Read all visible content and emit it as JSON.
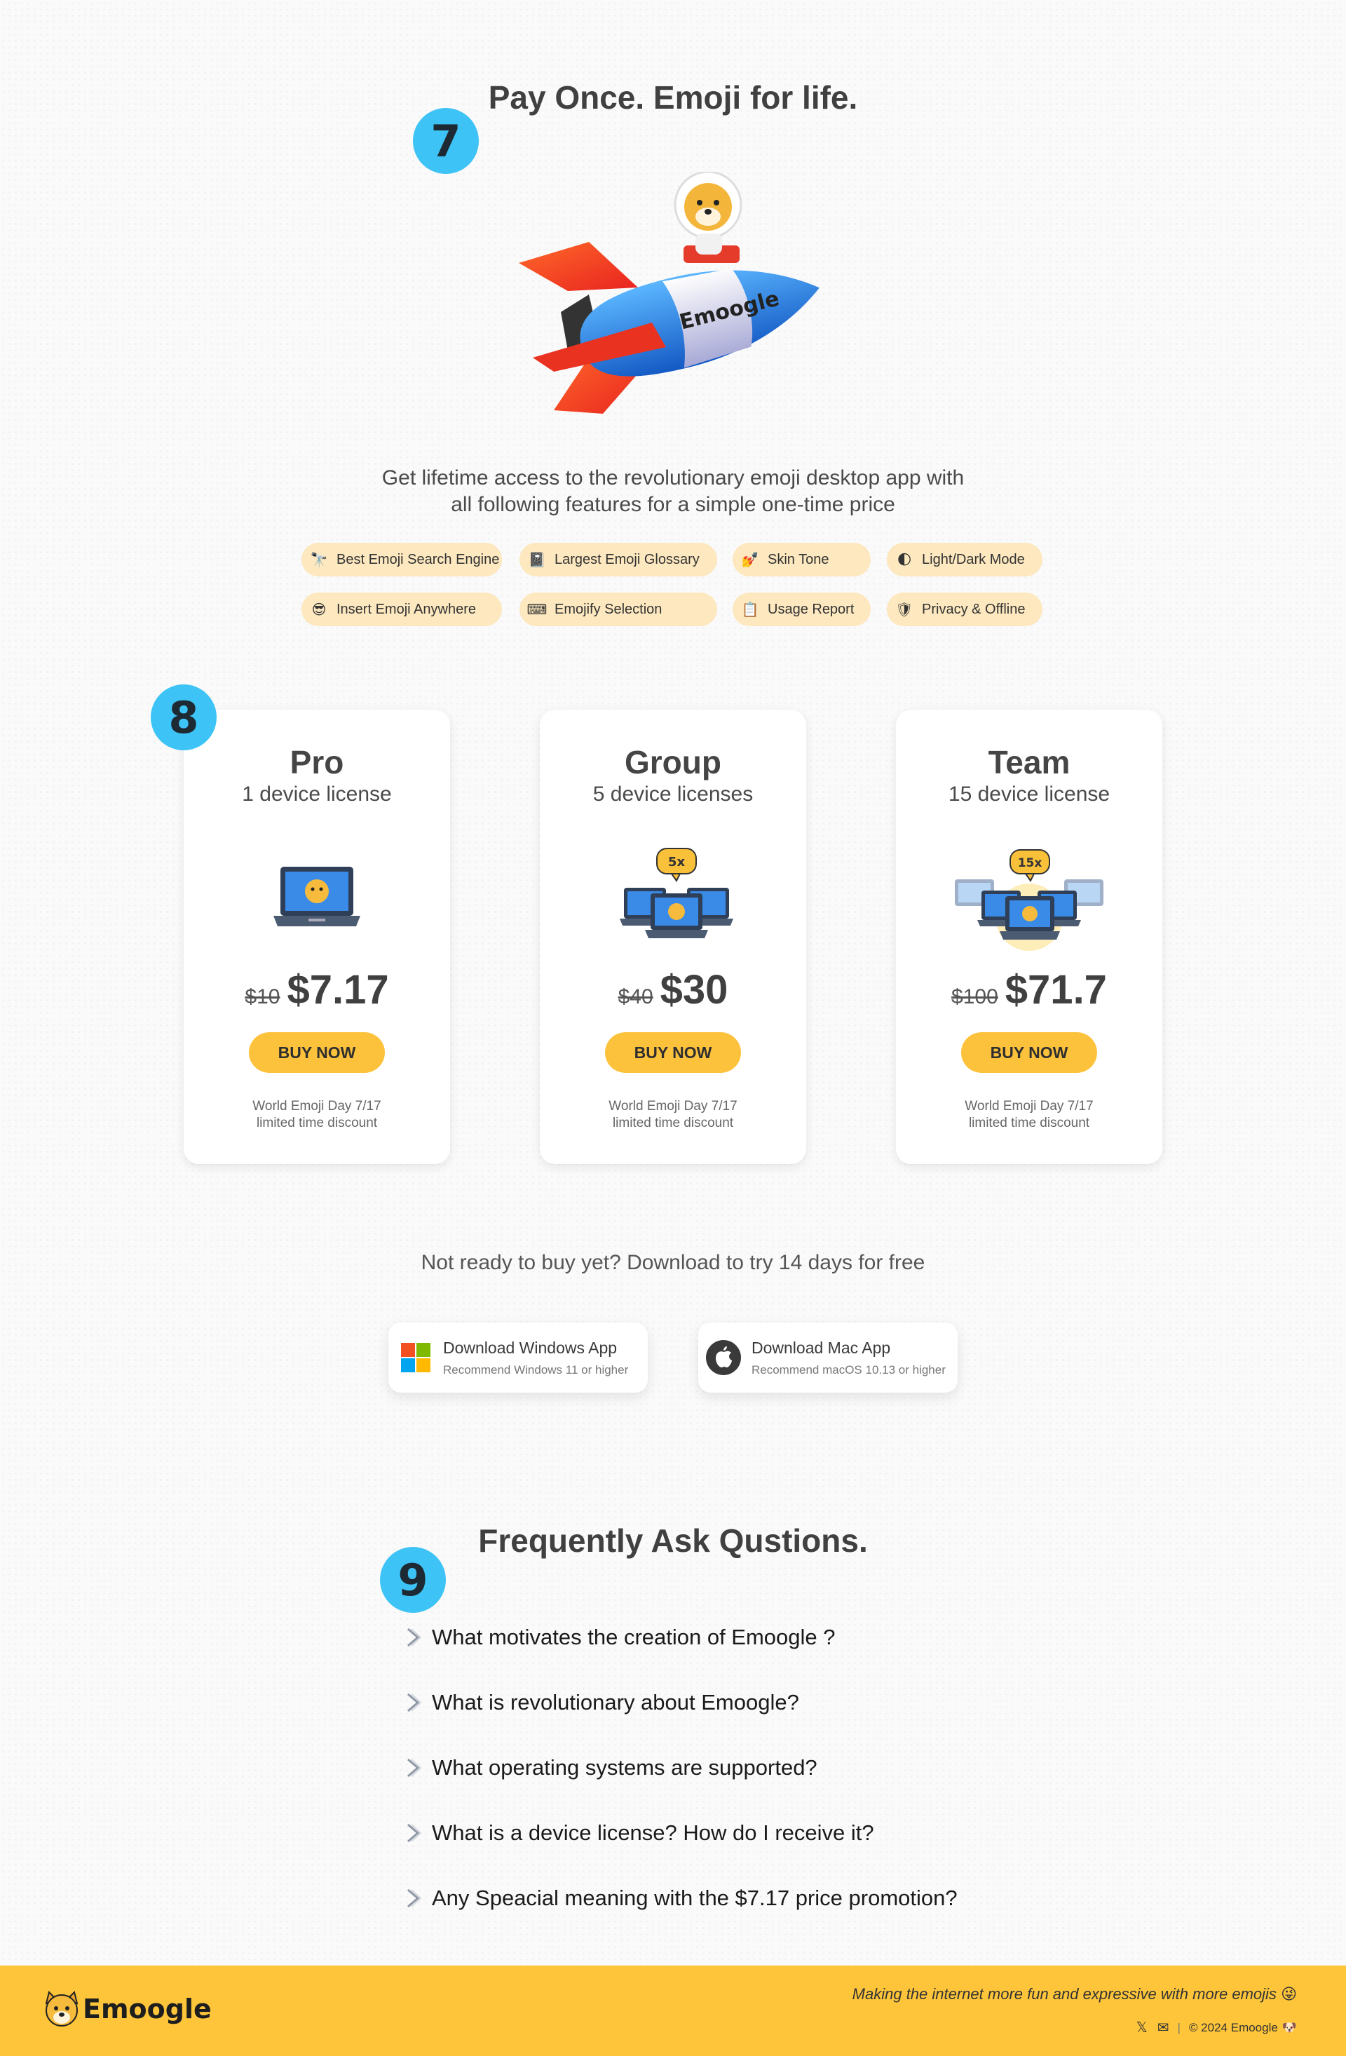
{
  "section7": {
    "badge": "7",
    "title": "Pay Once. Emoji for life.",
    "rocket_label": "Emoogle",
    "lead_line1": "Get lifetime access to the revolutionary emoji desktop app with",
    "lead_line2": "all following features for a simple one-time price",
    "features": [
      {
        "icon": "🔭",
        "label": "Best Emoji Search Engine"
      },
      {
        "icon": "📓",
        "label": "Largest Emoji Glossary"
      },
      {
        "icon": "💅",
        "label": "Skin Tone"
      },
      {
        "icon": "🌓",
        "label": "Light/Dark Mode"
      },
      {
        "icon": "😎",
        "label": "Insert Emoji Anywhere"
      },
      {
        "icon": "⌨",
        "label": "Emojify Selection"
      },
      {
        "icon": "📋",
        "label": "Usage Report"
      },
      {
        "icon": "🛡",
        "label": "Privacy & Offline"
      }
    ]
  },
  "section8": {
    "badge": "8",
    "plans": [
      {
        "name": "Pro",
        "license": "1 device license",
        "old_price": "$10",
        "price": "$7.17",
        "buy": "BUY NOW",
        "note1": "World Emoji Day 7/17",
        "note2": "limited time discount",
        "multiplier": ""
      },
      {
        "name": "Group",
        "license": "5 device licenses",
        "old_price": "$40",
        "price": "$30",
        "buy": "BUY NOW",
        "note1": "World Emoji Day 7/17",
        "note2": "limited time discount",
        "multiplier": "5x"
      },
      {
        "name": "Team",
        "license": "15 device license",
        "old_price": "$100",
        "price": "$71.7",
        "buy": "BUY NOW",
        "note1": "World Emoji Day 7/17",
        "note2": "limited time discount",
        "multiplier": "15x"
      }
    ],
    "trial_text": "Not ready to buy yet? Download to try 14 days for free",
    "downloads": {
      "windows": {
        "title": "Download Windows App",
        "subtitle": "Recommend Windows 11 or higher"
      },
      "mac": {
        "title": "Download Mac App",
        "subtitle": "Recommend macOS 10.13 or higher"
      }
    }
  },
  "section9": {
    "badge": "9",
    "title": "Frequently Ask Qustions.",
    "questions": [
      "What motivates the creation of Emoogle ?",
      "What is revolutionary about Emoogle?",
      "What operating systems are supported?",
      "What is a device license? How do I receive it?",
      "Any Speacial meaning with the $7.17 price promotion?"
    ]
  },
  "footer": {
    "brand": "Emoogle",
    "tagline": "Making the internet more fun and expressive with more emojis",
    "tagline_emoji": "😜",
    "x_icon": "𝕏",
    "mail_icon": "✉",
    "divider": "|",
    "copyright": "© 2024 Emoogle",
    "copyright_emoji": "🐶"
  },
  "colors": {
    "accent_blue": "#3dc3f5",
    "button_yellow": "#fdc23c",
    "chip_bg": "#fde8bf",
    "footer_bg": "#fec53a"
  }
}
